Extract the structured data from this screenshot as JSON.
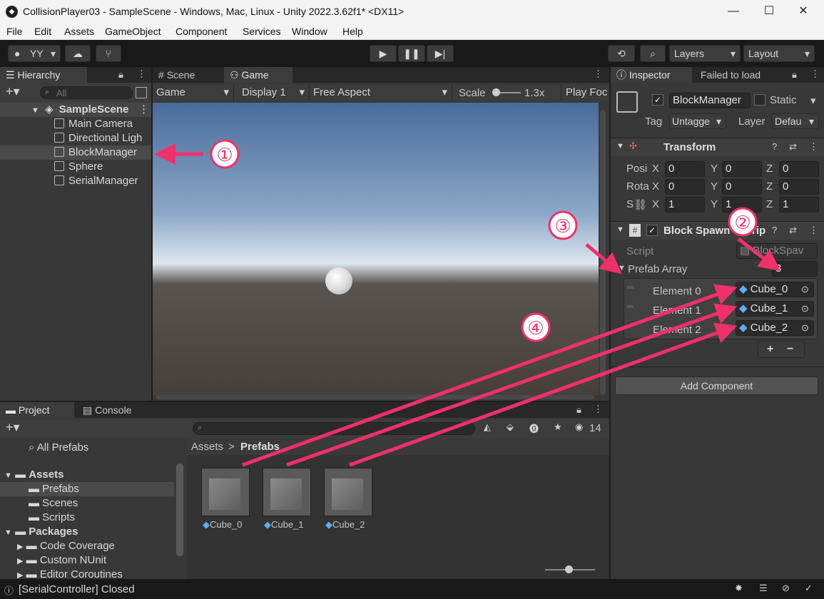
{
  "window": {
    "title": "CollisionPlayer03 - SampleScene - Windows, Mac, Linux - Unity 2022.3.62f1* <DX11>",
    "minimize": "—",
    "maximize": "☐",
    "close": "✕"
  },
  "menu": [
    "File",
    "Edit",
    "Assets",
    "GameObject",
    "Component",
    "Services",
    "Window",
    "Help"
  ],
  "toolbar": {
    "account": "YY",
    "layers": "Layers",
    "layout": "Layout"
  },
  "hierarchy": {
    "tab": "Hierarchy",
    "search_placeholder": "All",
    "scene": "SampleScene",
    "items": [
      "Main Camera",
      "Directional Ligh",
      "BlockManager",
      "Sphere",
      "SerialManager"
    ]
  },
  "scene_view": {
    "tabs": [
      "Scene",
      "Game"
    ],
    "game_dropdown": "Game",
    "display": "Display 1",
    "aspect": "Free Aspect",
    "scale_label": "Scale",
    "scale_value": "1.3x",
    "play_focused": "Play Foc"
  },
  "inspector": {
    "tabs": [
      "Inspector",
      "Failed to load"
    ],
    "object_name": "BlockManager",
    "static_label": "Static",
    "tag_label": "Tag",
    "tag_value": "Untagge",
    "layer_label": "Layer",
    "layer_value": "Defau",
    "transform": {
      "title": "Transform",
      "rows": [
        {
          "label": "Posi",
          "x": "0",
          "y": "0",
          "z": "0"
        },
        {
          "label": "Rota",
          "x": "0",
          "y": "0",
          "z": "0"
        },
        {
          "label": "S",
          "x": "1",
          "y": "1",
          "z": "1"
        }
      ]
    },
    "script_component": {
      "title": "Block Spawn",
      "title_tail": "rip",
      "script_label": "Script",
      "script_value": "BlockSpav",
      "array_label": "Prefab Array",
      "array_size": "3",
      "elements": [
        {
          "label": "Element 0",
          "value": "Cube_0"
        },
        {
          "label": "Element 1",
          "value": "Cube_1"
        },
        {
          "label": "Element 2",
          "value": "Cube_2"
        }
      ],
      "add": "+",
      "remove": "−"
    },
    "add_component": "Add Component"
  },
  "project": {
    "tabs": [
      "Project",
      "Console"
    ],
    "all_prefabs": "All Prefabs",
    "tree": [
      {
        "label": "Assets",
        "bold": true
      },
      {
        "label": "Prefabs",
        "selected": true
      },
      {
        "label": "Scenes"
      },
      {
        "label": "Scripts"
      },
      {
        "label": "Packages",
        "bold": true
      },
      {
        "label": "Code Coverage"
      },
      {
        "label": "Custom NUnit"
      },
      {
        "label": "Editor Coroutines"
      }
    ],
    "breadcrumb_root": "Assets",
    "breadcrumb_sep": ">",
    "breadcrumb_current": "Prefabs",
    "hidden_count": "14",
    "assets": [
      "Cube_0",
      "Cube_1",
      "Cube_2"
    ]
  },
  "status_bar": {
    "message": "[SerialController] Closed"
  },
  "annotations": [
    "①",
    "②",
    "③",
    "④"
  ],
  "colors": {
    "accent_arrow": "#f0306a",
    "selection": "#2c5d87",
    "panel": "#383838"
  }
}
